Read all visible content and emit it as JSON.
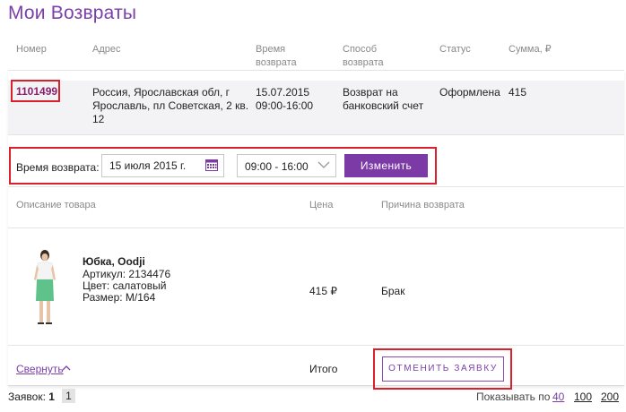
{
  "page": {
    "title": "Мои Возвраты"
  },
  "table_headers": {
    "number": "Номер",
    "address": "Адрес",
    "time_line1": "Время",
    "time_line2": "возврата",
    "method_line1": "Способ",
    "method_line2": "возврата",
    "status": "Статус",
    "sum": "Сумма, ₽"
  },
  "order": {
    "number": "1101499",
    "address_lines": [
      "Россия, Ярославская обл, г",
      "Ярославль, пл Советская, 2 кв.",
      "12"
    ],
    "date": "15.07.2015",
    "time": "09:00-16:00",
    "method_lines": [
      "Возврат на",
      "банковский счет"
    ],
    "status": "Оформлена",
    "sum": "415"
  },
  "return_time": {
    "label": "Время возврата:",
    "date_value": "15 июля 2015 г.",
    "time_value": "09:00 - 16:00",
    "change_button": "Изменить"
  },
  "items_headers": {
    "description": "Описание товара",
    "price": "Цена",
    "reason": "Причина возврата"
  },
  "item": {
    "name": "Юбка, Oodji",
    "article_label": "Артикул:",
    "article_value": "2134476",
    "color_label": "Цвет:",
    "color_value": "салатовый",
    "size_label": "Размер:",
    "size_value": "M/164",
    "price": "415 ₽",
    "reason": "Брак"
  },
  "footer": {
    "collapse": "Свернуть",
    "total_label": "Итого",
    "cancel_button": "ОТМЕНИТЬ ЗАЯВКУ"
  },
  "pagination": {
    "label": "Заявок:",
    "count": "1",
    "current_page": "1",
    "show_label": "Показывать по",
    "options": [
      "40",
      "100",
      "200"
    ]
  },
  "colors": {
    "accent": "#7b3aa6",
    "highlight": "#d9202b",
    "row_bg": "#f3f3f6",
    "order_link": "#8a1f6e"
  }
}
